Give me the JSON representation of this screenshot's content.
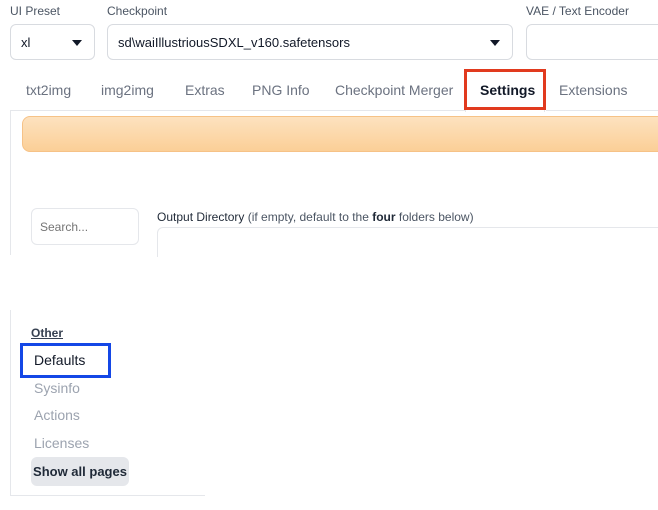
{
  "top_bar": {
    "ui_preset": {
      "label": "UI Preset",
      "value": "xl"
    },
    "checkpoint": {
      "label": "Checkpoint",
      "value": "sd\\waiIllustriousSDXL_v160.safetensors"
    },
    "vae": {
      "label": "VAE / Text Encoder",
      "value": ""
    }
  },
  "tabs": [
    {
      "label": "txt2img"
    },
    {
      "label": "img2img"
    },
    {
      "label": "Extras"
    },
    {
      "label": "PNG Info"
    },
    {
      "label": "Checkpoint Merger"
    },
    {
      "label": "Settings"
    },
    {
      "label": "Extensions"
    }
  ],
  "active_tab": "Settings",
  "settings": {
    "search_placeholder": "Search...",
    "output_directory": {
      "label_main": "Output Directory",
      "label_hint_prefix": " (if empty, default to the ",
      "label_hint_bold": "four",
      "label_hint_suffix": " folders below)",
      "value": ""
    },
    "sidebar": {
      "section_title": "Other",
      "items": [
        {
          "label": "Defaults"
        },
        {
          "label": "Sysinfo"
        },
        {
          "label": "Actions"
        },
        {
          "label": "Licenses"
        }
      ],
      "show_all_label": "Show all pages"
    }
  },
  "colors": {
    "highlight_red": "#e13a1e",
    "highlight_blue": "#1447e6",
    "banner_orange": "#fcd7a8"
  }
}
